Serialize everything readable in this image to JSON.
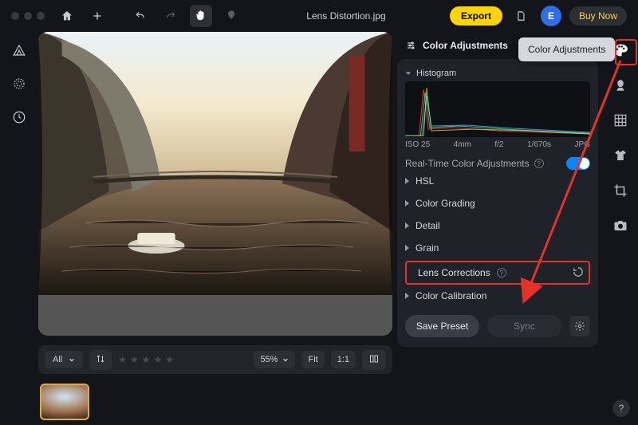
{
  "header": {
    "filename": "Lens Distortion.jpg",
    "export_label": "Export",
    "avatar_letter": "E",
    "buy_label": "Buy Now"
  },
  "tooltip": {
    "text": "Color Adjustments"
  },
  "panel": {
    "title": "Color Adjustments",
    "histogram_label": "Histogram",
    "hist_meta": {
      "iso": "ISO 25",
      "focal": "4mm",
      "aperture": "f/2",
      "shutter": "1/670s",
      "format": "JPG"
    },
    "realtime_label": "Real-Time Color Adjustments",
    "realtime_on": true,
    "sections": {
      "hsl": "HSL",
      "grading": "Color Grading",
      "detail": "Detail",
      "grain": "Grain",
      "lens": "Lens Corrections",
      "calibration": "Color Calibration"
    },
    "save_preset": "Save Preset",
    "sync": "Sync"
  },
  "bottom": {
    "filter_label": "All",
    "rating_scale": 5,
    "zoom": "55%",
    "fit": "Fit",
    "onetoone": "1:1"
  },
  "leftrail_tools": [
    "triangle-tool",
    "circle-ring-tool",
    "history-tool"
  ],
  "rightrail_tools": [
    "palette-icon",
    "portrait-icon",
    "grid-icon",
    "tshirt-icon",
    "crop-icon",
    "camera-icon"
  ]
}
